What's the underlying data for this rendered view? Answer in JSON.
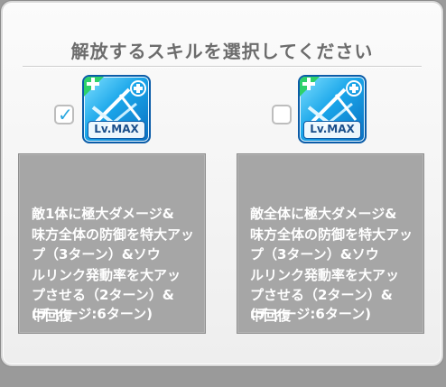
{
  "title": "解放するスキルを選択してください",
  "options": [
    {
      "checked": true,
      "icon": "skill-sword-plus-icon",
      "level_badge": "Lv.MAX",
      "description": "敵1体に極大ダメージ&\n味方全体の防御を特大アッ\nプ（3ターン）&ソウ\nルリンク発動率を大アッ\nプさせる（2ターン）&\n中回復",
      "cooldown": "(チャージ:6ターン)"
    },
    {
      "checked": false,
      "icon": "skill-sword-plus-icon",
      "level_badge": "Lv.MAX",
      "description": "敵全体に極大ダメージ&\n味方全体の防御を特大アッ\nプ（3ターン）&ソウ\nルリンク発動率を大アッ\nプさせる（2ターン）&\n中回復",
      "cooldown": "(チャージ:6ターン)"
    }
  ],
  "colors": {
    "title": "#6c6c6c",
    "checkmark": "#2aa8e0",
    "panel": "#a6a6a6",
    "icon_bg": "#1aa6ea"
  }
}
